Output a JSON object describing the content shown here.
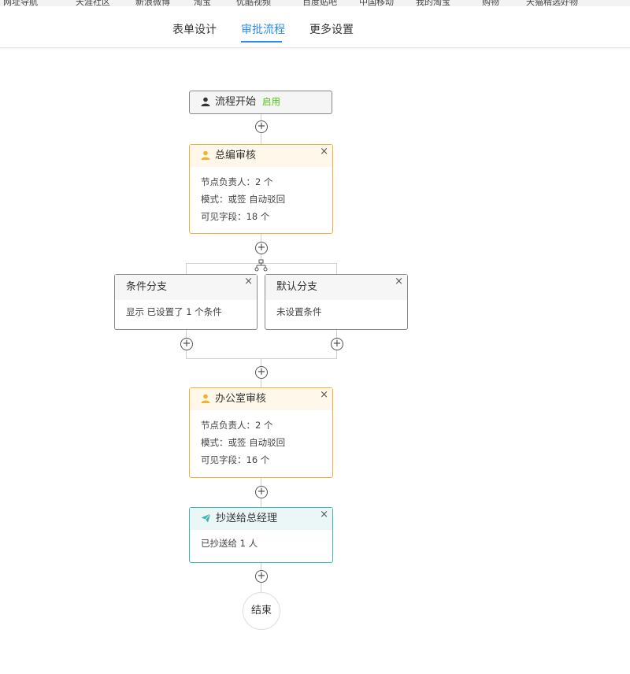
{
  "bookmarks": [
    "网址导航",
    "天涯社区",
    "新浪微博",
    "淘宝",
    "优酷视频",
    "百度贴吧",
    "中国移动",
    "我的淘宝",
    "购物",
    "天猫精选好物"
  ],
  "tabs": [
    {
      "label": "表单设计",
      "active": false
    },
    {
      "label": "审批流程",
      "active": true
    },
    {
      "label": "更多设置",
      "active": false
    }
  ],
  "flow": {
    "start": {
      "label": "流程开始",
      "status": "启用"
    },
    "approver1": {
      "title": "总编审核",
      "lines": [
        "节点负责人：2 个",
        "模式：或签   自动驳回",
        "可见字段：18 个"
      ]
    },
    "branch_left": {
      "title": "条件分支",
      "desc": "显示 已设置了 1 个条件"
    },
    "branch_right": {
      "title": "默认分支",
      "desc": "未设置条件"
    },
    "approver2": {
      "title": "办公室审核",
      "lines": [
        "节点负责人：2 个",
        "模式：或签   自动驳回",
        "可见字段：16 个"
      ]
    },
    "cc": {
      "title": "抄送给总经理",
      "desc": "已抄送给 1 人"
    },
    "end": {
      "label": "结束"
    }
  },
  "colors": {
    "accent": "#2d8cf0",
    "approver": "#f0b232",
    "cc": "#3fb5ad",
    "status_on": "#52c41a"
  },
  "icons": {
    "close": "×",
    "add": "+"
  }
}
